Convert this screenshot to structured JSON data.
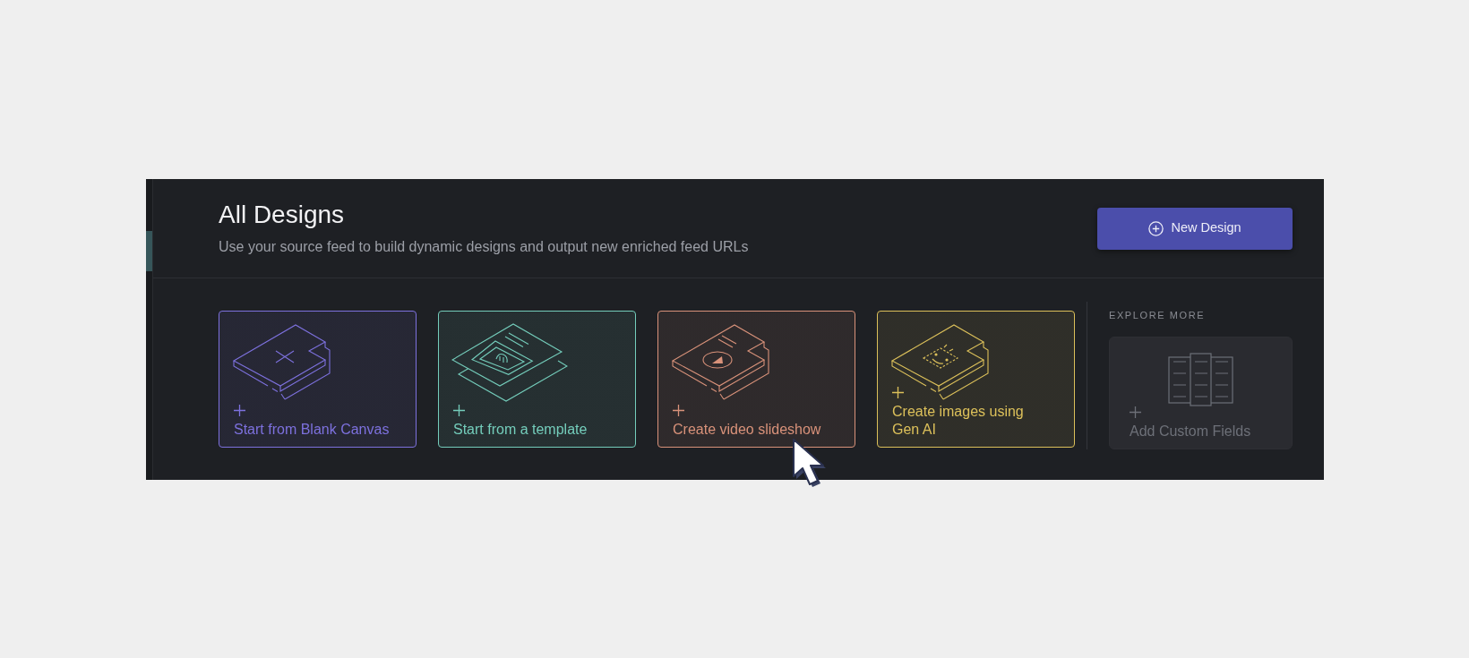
{
  "header": {
    "title": "All Designs",
    "subtitle": "Use your source feed to build dynamic designs and output new enriched feed URLs",
    "primary_button": {
      "label": "New Design"
    }
  },
  "create_options": [
    {
      "kind": "blank",
      "label": "Start from Blank Canvas",
      "color": "#7d71de"
    },
    {
      "kind": "template",
      "label": "Start from a template",
      "color": "#74cdbb"
    },
    {
      "kind": "video",
      "label": "Create video slideshow",
      "color": "#d9927a"
    },
    {
      "kind": "ai",
      "label": "Create images using Gen AI",
      "color": "#dcc05a"
    }
  ],
  "explore_more": {
    "heading": "EXPLORE MORE",
    "items": [
      {
        "label": "Add Custom Fields"
      }
    ]
  }
}
